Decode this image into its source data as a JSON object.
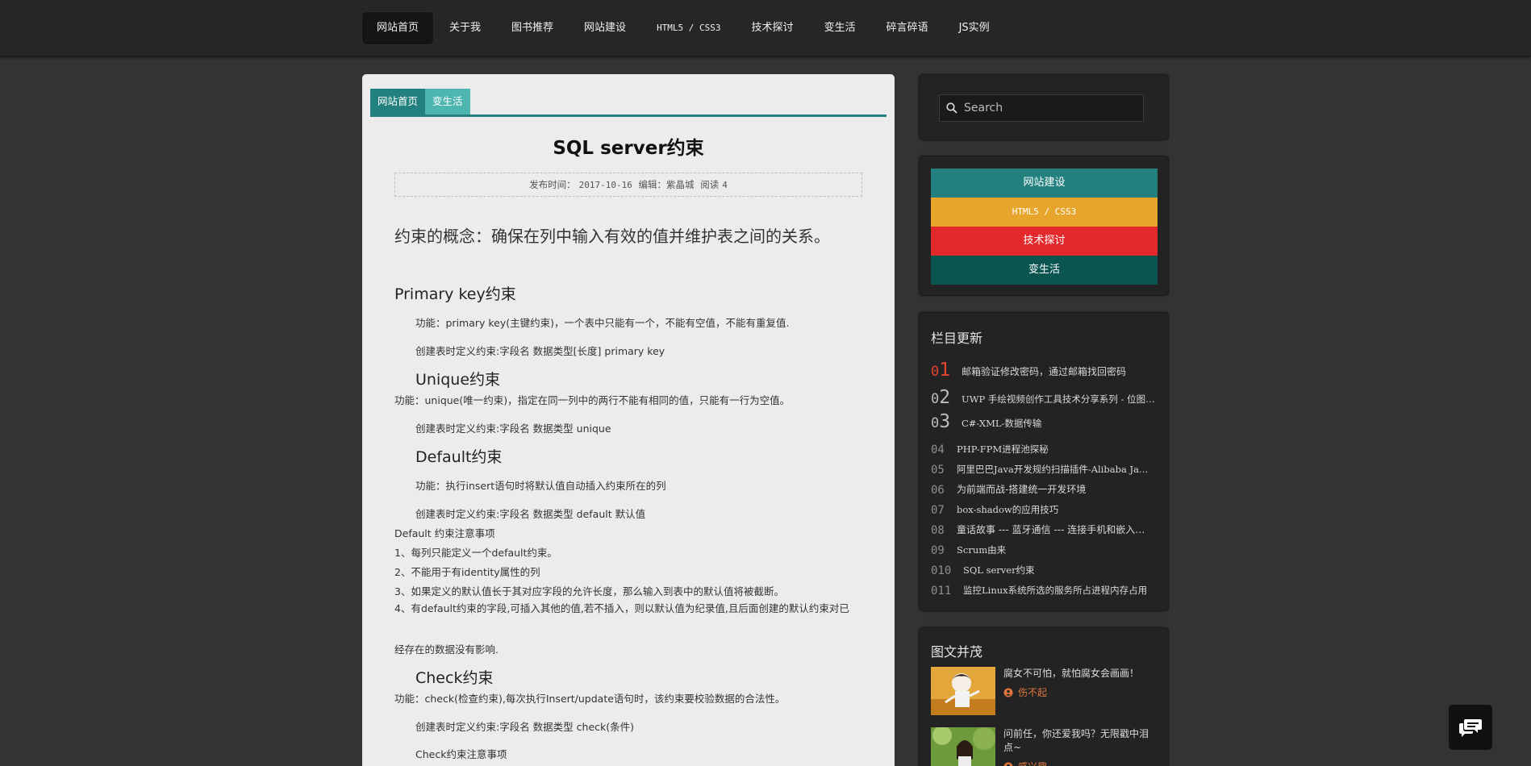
{
  "nav": {
    "items": [
      {
        "label": "网站首页"
      },
      {
        "label": "关于我"
      },
      {
        "label": "图书推荐"
      },
      {
        "label": "网站建设"
      },
      {
        "label": "HTML5 / CSS3"
      },
      {
        "label": "技术探讨"
      },
      {
        "label": "变生活"
      },
      {
        "label": "碎言碎语"
      },
      {
        "label": "JS实例"
      }
    ]
  },
  "breadcrumb": [
    "网站首页",
    "变生活"
  ],
  "article": {
    "title": "SQL server约束",
    "meta": {
      "date_label": "发布时间：",
      "date": "2017-10-16",
      "editor_label": "编辑：紫晶城",
      "reads_label": "阅读",
      "reads": "4"
    },
    "lead": "约束的概念：确保在列中输入有效的值并维护表之间的关系。",
    "pk_heading": "Primary key约束",
    "pk_func": "功能：primary key(主键约束)，一个表中只能有一个，不能有空值，不能有重复值.",
    "pk_syntax": "创建表时定义约束:字段名 数据类型[长度] primary key",
    "uq_heading": "Unique约束",
    "uq_func": "功能：unique(唯一约束)，指定在同一列中的两行不能有相同的值，只能有一行为空值。",
    "uq_syntax": "创建表时定义约束:字段名 数据类型 unique",
    "df_heading": "Default约束",
    "df_func": "功能：执行insert语句时将默认值自动插入约束所在的列",
    "df_syntax": "创建表时定义约束:字段名 数据类型 default 默认值",
    "df_notes_title": "Default 约束注意事项",
    "df_note1": "1、每列只能定义一个default约束。",
    "df_note2": "2、不能用于有identity属性的列",
    "df_note3": "3、如果定义的默认值长于其对应字段的允许长度，那么输入到表中的默认值将被截断。",
    "df_note4": "4、有default约束的字段,可插入其他的值,若不插入，则以默认值为纪录值,且后面创建的默认约束对已",
    "df_note4b": "经存在的数据没有影响.",
    "ck_heading": "Check约束",
    "ck_func": "功能：check(检查约束),每次执行Insert/update语句时，该约束要校验数据的合法性。",
    "ck_syntax": "创建表时定义约束:字段名 数据类型 check(条件)",
    "ck_notes_title": "Check约束注意事项"
  },
  "search": {
    "placeholder": "Search"
  },
  "categories": [
    {
      "label": "网站建设",
      "color": "#22817f"
    },
    {
      "label": "HTML5 / CSS3",
      "color": "#e7a62b"
    },
    {
      "label": "技术探讨",
      "color": "#e3292b"
    },
    {
      "label": "变生活",
      "color": "#0b5551"
    }
  ],
  "updates": {
    "title": "栏目更新",
    "items": [
      {
        "num_prefix": "0",
        "num_main": "1",
        "text": "邮箱验证修改密码，通过邮箱找回密码"
      },
      {
        "num_prefix": "0",
        "num_main": "2",
        "text": "UWP 手绘视频创作工具技术分享系列 - 位图的绘制与撤销"
      },
      {
        "num_prefix": "0",
        "num_main": "3",
        "text": "C#-XML-数据传输"
      },
      {
        "num": "04",
        "text": "PHP-FPM进程池探秘"
      },
      {
        "num": "05",
        "text": "阿里巴巴Java开发规约扫描插件-Alibaba Java Coding Guidelines"
      },
      {
        "num": "06",
        "text": "为前端而战-搭建统一开发环境"
      },
      {
        "num": "07",
        "text": "box-shadow的应用技巧"
      },
      {
        "num": "08",
        "text": "童话故事 --- 蓝牙通信 --- 连接手机和嵌入式设备"
      },
      {
        "num": "09",
        "text": "Scrum由来"
      },
      {
        "num": "010",
        "text": "SQL server约束"
      },
      {
        "num": "011",
        "text": "监控Linux系统所选的服务所占进程内存占用"
      }
    ]
  },
  "pictures": {
    "title": "图文并茂",
    "items": [
      {
        "title": "腐女不可怕，就怕腐女会画画！",
        "author": "伤不起"
      },
      {
        "title": "问前任，你还爱我吗？无限戳中泪点~",
        "author": "感兴趣"
      }
    ]
  }
}
